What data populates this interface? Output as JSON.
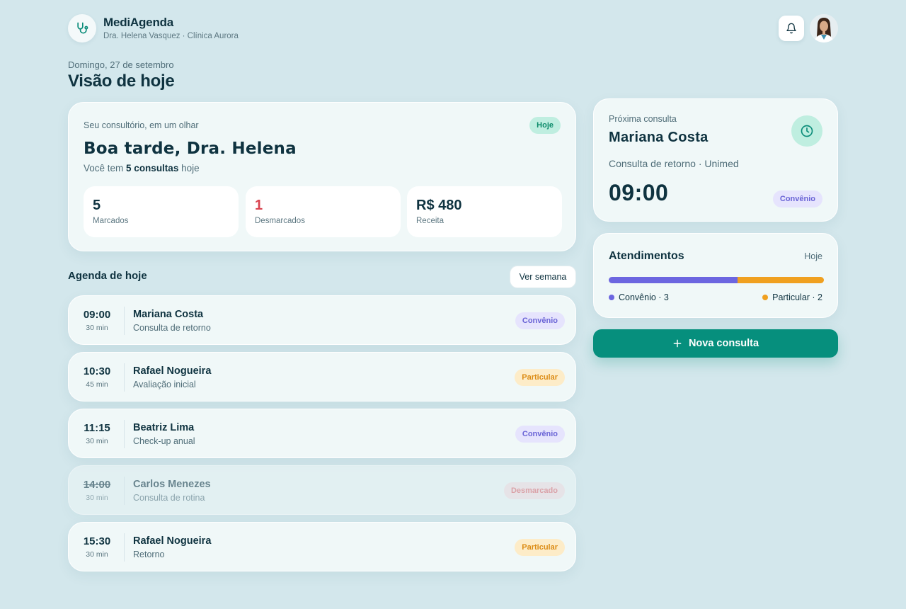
{
  "header": {
    "app_name": "MediAgenda",
    "subtitle": "Dra. Helena Vasquez · Clínica Aurora",
    "logo_icon": "stethoscope-icon",
    "notification_icon": "bell-icon"
  },
  "date_line": "Domingo, 27 de setembro",
  "page_title": "Visão de hoje",
  "overview": {
    "kicker": "Seu consultório, em um olhar",
    "badge": "Hoje",
    "greeting": "Boa tarde, Dra. Helena",
    "summary_prefix": "Você tem",
    "summary_count": "5 consultas",
    "summary_suffix": "hoje",
    "stats": [
      {
        "value": "5",
        "label": "Marcados",
        "color": "#0f3340"
      },
      {
        "value": "1",
        "label": "Desmarcados",
        "color": "#d9434f"
      },
      {
        "value": "R$ 480",
        "label": "Receita",
        "color": "#0f3340"
      }
    ]
  },
  "agenda": {
    "title": "Agenda de hoje",
    "week_button": "Ver semana",
    "appointments": [
      {
        "time": "09:00",
        "duration": "30 min",
        "name": "Mariana Costa",
        "type": "Consulta de retorno",
        "tag": "Convênio",
        "status": "conv"
      },
      {
        "time": "10:30",
        "duration": "45 min",
        "name": "Rafael Nogueira",
        "type": "Avaliação inicial",
        "tag": "Particular",
        "status": "part"
      },
      {
        "time": "11:15",
        "duration": "30 min",
        "name": "Beatriz Lima",
        "type": "Check-up anual",
        "tag": "Convênio",
        "status": "conv"
      },
      {
        "time": "14:00",
        "duration": "30 min",
        "name": "Carlos Menezes",
        "type": "Consulta de rotina",
        "tag": "Desmarcado",
        "status": "desm"
      },
      {
        "time": "15:30",
        "duration": "30 min",
        "name": "Rafael Nogueira",
        "type": "Retorno",
        "tag": "Particular",
        "status": "part"
      }
    ]
  },
  "next_appointment": {
    "kicker": "Próxima consulta",
    "name": "Mariana Costa",
    "description": "Consulta de retorno · Unimed",
    "time": "09:00",
    "tag": "Convênio",
    "icon": "clock-icon"
  },
  "attendance": {
    "title": "Atendimentos",
    "period": "Hoje",
    "convenio_label": "Convênio · 3",
    "particular_label": "Particular · 2",
    "convenio_count": 3,
    "particular_count": 2,
    "convenio_color": "#6c66e0",
    "particular_color": "#f0a020"
  },
  "new_button": {
    "label": "Nova consulta",
    "icon": "plus-icon"
  },
  "colors": {
    "accent": "#068f7d",
    "background": "#d3e7ec"
  }
}
